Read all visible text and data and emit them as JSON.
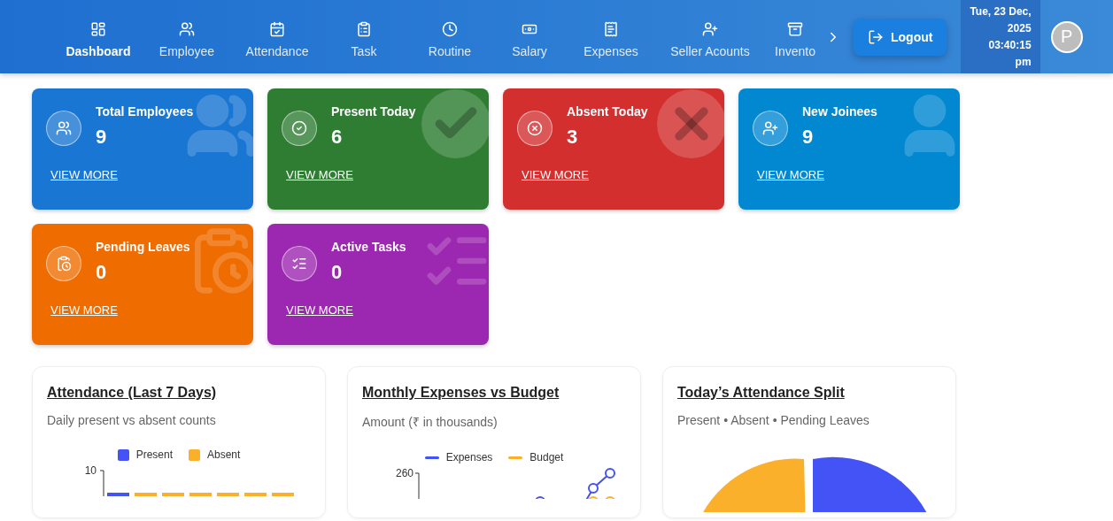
{
  "nav": {
    "items": [
      {
        "kind": "dashboard",
        "label": "Dashboard",
        "selected": true
      },
      {
        "kind": "employee",
        "label": "Employee",
        "selected": false
      },
      {
        "kind": "attendance",
        "label": "Attendance",
        "selected": false
      },
      {
        "kind": "task",
        "label": "Task",
        "selected": false
      },
      {
        "kind": "routine",
        "label": "Routine",
        "selected": false
      },
      {
        "kind": "salary",
        "label": "Salary",
        "selected": false
      },
      {
        "kind": "expenses",
        "label": "Expenses",
        "selected": false
      },
      {
        "kind": "seller",
        "label": "Seller Acounts",
        "selected": false
      },
      {
        "kind": "inventory",
        "label": "Invento",
        "selected": false
      }
    ],
    "logout": "Logout",
    "datetime": [
      "Tue, 23 Dec,",
      "2025",
      "03:40:15",
      "pm"
    ],
    "avatar": "P"
  },
  "stats": [
    {
      "kind": "employees",
      "title": "Total Employees",
      "value": "9",
      "link": "VIEW MORE",
      "color": "#1976d2"
    },
    {
      "kind": "present",
      "title": "Present Today",
      "value": "6",
      "link": "VIEW MORE",
      "color": "#2e7d32"
    },
    {
      "kind": "absent",
      "title": "Absent Today",
      "value": "3",
      "link": "VIEW MORE",
      "color": "#d32f2f"
    },
    {
      "kind": "joinees",
      "title": "New Joinees",
      "value": "9",
      "link": "VIEW MORE",
      "color": "#0288d1"
    },
    {
      "kind": "leaves",
      "title": "Pending Leaves",
      "value": "0",
      "link": "VIEW MORE",
      "color": "#ef6c00"
    },
    {
      "kind": "tasks",
      "title": "Active Tasks",
      "value": "0",
      "link": "VIEW MORE",
      "color": "#9c27b0"
    }
  ],
  "charts": [
    {
      "kind": "bar",
      "title": "Attendance (Last 7 Days)",
      "subtitle": "Daily present vs absent counts",
      "legend": [
        {
          "label": "Present",
          "color": "#4353f5"
        },
        {
          "label": "Absent",
          "color": "#fbb02c"
        }
      ],
      "tick": "10"
    },
    {
      "kind": "line",
      "title": "Monthly Expenses vs Budget",
      "subtitle": "Amount (₹ in thousands)",
      "legend": [
        {
          "label": "Expenses",
          "color": "#4353f5"
        },
        {
          "label": "Budget",
          "color": "#fbb02c"
        }
      ],
      "tick": "260"
    },
    {
      "kind": "pie",
      "title": "Today’s Attendance Split",
      "subtitle": "Present • Absent • Pending Leaves"
    }
  ]
}
